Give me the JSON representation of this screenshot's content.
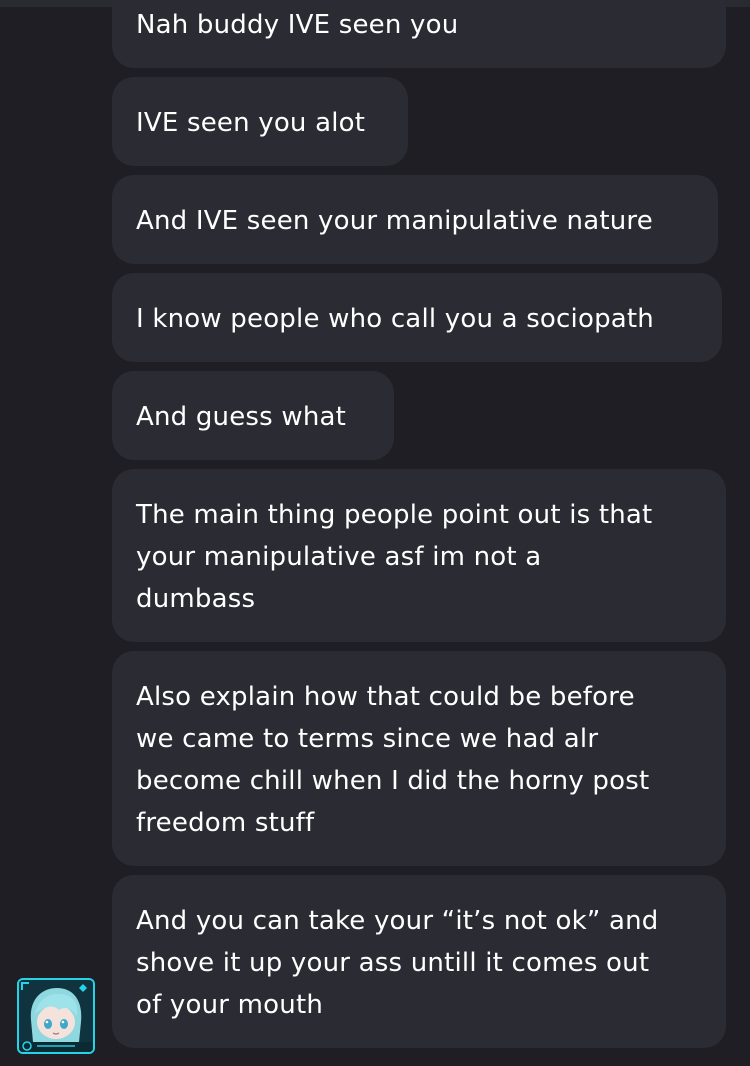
{
  "messages": [
    {
      "lines": [
        "Nah buddy IVE seen you"
      ]
    },
    {
      "lines": [
        "IVE seen you alot"
      ]
    },
    {
      "lines": [
        "And IVE seen your manipulative nature"
      ]
    },
    {
      "lines": [
        "I know people who call you a sociopath"
      ]
    },
    {
      "lines": [
        "And guess what"
      ]
    },
    {
      "lines": [
        "The main thing people point out is that",
        "your manipulative asf im not a",
        "dumbass"
      ]
    },
    {
      "lines": [
        "Also explain how that could be before",
        "we came to terms since we had alr",
        "become chill when I did the horny post",
        "freedom stuff"
      ]
    },
    {
      "lines": [
        "And you can take your “it’s not ok” and",
        "shove it up your ass untill it comes out",
        "of your mouth"
      ]
    }
  ],
  "avatar": {
    "icon": "anime-character-avatar-icon",
    "accent": "#27d3e6"
  },
  "colors": {
    "background": "#1e1e24",
    "bubble": "#2b2b33",
    "text": "#ffffff"
  }
}
